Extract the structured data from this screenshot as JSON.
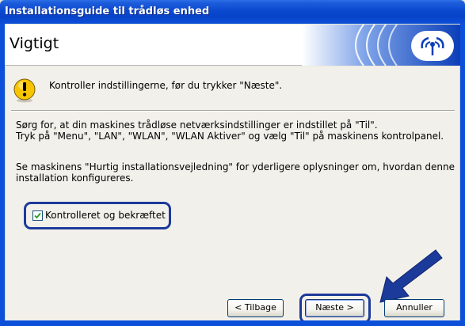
{
  "window": {
    "title": "Installationsguide til trådløs enhed"
  },
  "header": {
    "heading": "Vigtigt"
  },
  "warning": {
    "icon": "warning-icon",
    "text": "Kontroller indstillingerne, før du trykker \"Næste\"."
  },
  "body": {
    "paragraph1": [
      "Sørg for, at din maskines trådløse netværksindstillinger er indstillet på \"Til\".",
      "Tryk på \"Menu\", \"LAN\", \"WLAN\", \"WLAN Aktiver\" og vælg \"Til\" på maskinens kontrolpanel."
    ],
    "paragraph2": [
      "Se maskinens \"Hurtig installationsvejledning\" for yderligere oplysninger om, hvordan denne",
      "installation konfigureres."
    ]
  },
  "confirm": {
    "label": "Kontrolleret og bekræftet",
    "checked": true
  },
  "buttons": {
    "back": "< Tilbage",
    "next": "Næste >",
    "cancel": "Annuller"
  },
  "colors": {
    "titlebar": "#0a49d0",
    "highlight": "#1c3a9a",
    "panel": "#f2f0ea"
  }
}
